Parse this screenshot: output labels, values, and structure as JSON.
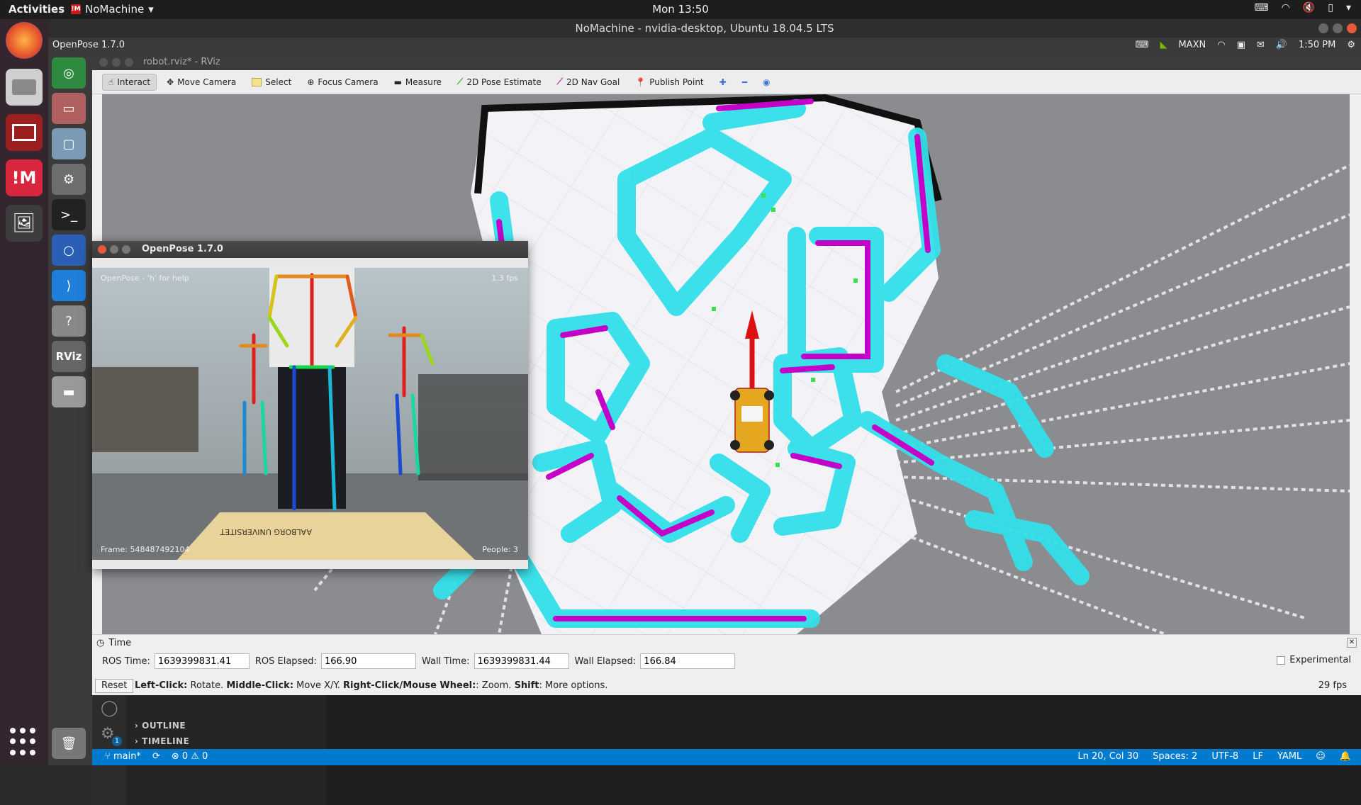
{
  "topbar": {
    "activities": "Activities",
    "app_name": "NoMachine",
    "clock": "Mon 13:50"
  },
  "nomachine_title": "NoMachine - nvidia-desktop, Ubuntu 18.04.5 LTS",
  "jetson_panel": {
    "title": "OpenPose 1.7.0",
    "power_mode": "MAXN",
    "time": "1:50 PM"
  },
  "rviz": {
    "window_title": "robot.rviz* - RViz",
    "tools": [
      {
        "label": "Interact",
        "icon": "hand-icon",
        "active": true
      },
      {
        "label": "Move Camera",
        "icon": "move-camera-icon"
      },
      {
        "label": "Select",
        "icon": "select-icon"
      },
      {
        "label": "Focus Camera",
        "icon": "focus-camera-icon"
      },
      {
        "label": "Measure",
        "icon": "measure-icon"
      },
      {
        "label": "2D Pose Estimate",
        "icon": "pose-estimate-icon"
      },
      {
        "label": "2D Nav Goal",
        "icon": "nav-goal-icon"
      },
      {
        "label": "Publish Point",
        "icon": "publish-point-icon"
      }
    ],
    "time_panel": {
      "title": "Time",
      "ros_time_label": "ROS Time:",
      "ros_time": "1639399831.41",
      "ros_elapsed_label": "ROS Elapsed:",
      "ros_elapsed": "166.90",
      "wall_time_label": "Wall Time:",
      "wall_time": "1639399831.44",
      "wall_elapsed_label": "Wall Elapsed:",
      "wall_elapsed": "166.84",
      "experimental": "Experimental"
    },
    "status": {
      "reset": "Reset",
      "hint_parts": [
        "Left-Click:",
        " Rotate. ",
        "Middle-Click:",
        " Move X/Y. ",
        "Right-Click/Mouse Wheel:",
        ": Zoom. ",
        "Shift",
        ": More options."
      ],
      "fps": "29 fps"
    }
  },
  "openpose": {
    "title": "OpenPose 1.7.0",
    "help": "OpenPose - 'h' for help",
    "fps": "1.3 fps",
    "frame": "Frame: 548487492104",
    "people": "People: 3"
  },
  "vscode": {
    "outline": "OUTLINE",
    "timeline": "TIMELINE",
    "branch": "main*",
    "problems": "⊗ 0 ⚠ 0",
    "position": "Ln 20, Col 30",
    "spaces": "Spaces: 2",
    "encoding": "UTF-8",
    "eol": "LF",
    "language": "YAML",
    "badge": "1"
  },
  "colors": {
    "inflation": "#33e0ea",
    "obstacle": "#c400c8",
    "wall": "#111111",
    "free": "#f3f3f7",
    "vscode_status": "#007acc"
  }
}
